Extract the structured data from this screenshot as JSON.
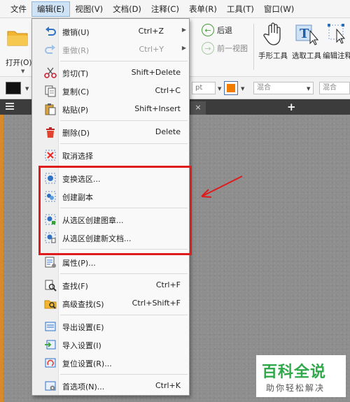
{
  "menubar": [
    "文件",
    "编辑(E)",
    "视图(V)",
    "文档(D)",
    "注释(C)",
    "表单(R)",
    "工具(T)",
    "窗口(W)"
  ],
  "ribbon": {
    "open_label": "打开(O)",
    "back_label": "后退",
    "forward_label": "前一视图",
    "hand_tool": "手形工具",
    "select_tool": "选取工具",
    "edit_annot": "编辑注释"
  },
  "format_bar": {
    "font_size_suffix": "pt",
    "blend1": "混合",
    "blend2": "混合"
  },
  "menu": {
    "undo": {
      "label": "撤销(U)",
      "shortcut": "Ctrl+Z"
    },
    "redo": {
      "label": "重做(R)",
      "shortcut": "Ctrl+Y"
    },
    "cut": {
      "label": "剪切(T)",
      "shortcut": "Shift+Delete"
    },
    "copy": {
      "label": "复制(C)",
      "shortcut": "Ctrl+C"
    },
    "paste": {
      "label": "粘贴(P)",
      "shortcut": "Shift+Insert"
    },
    "delete": {
      "label": "删除(D)",
      "shortcut": "Delete"
    },
    "deselect": {
      "label": "取消选择"
    },
    "transform": {
      "label": "变换选区..."
    },
    "duplicate": {
      "label": "创建副本"
    },
    "create_stamp": {
      "label": "从选区创建图章..."
    },
    "create_doc": {
      "label": "从选区创建新文档..."
    },
    "properties": {
      "label": "属性(P)..."
    },
    "find": {
      "label": "查找(F)",
      "shortcut": "Ctrl+F"
    },
    "advanced_find": {
      "label": "高级查找(S)",
      "shortcut": "Ctrl+Shift+F"
    },
    "export_settings": {
      "label": "导出设置(E)"
    },
    "import_settings": {
      "label": "导入设置(I)"
    },
    "reset_settings": {
      "label": "复位设置(R)..."
    },
    "preferences": {
      "label": "首选项(N)...",
      "shortcut": "Ctrl+K"
    }
  },
  "watermark": {
    "title": "百科全说",
    "subtitle": "助你轻松解决"
  },
  "colors": {
    "accent_red": "#e11b1b",
    "text_color": "#f07d00",
    "watermark_green": "#2fa94a"
  }
}
